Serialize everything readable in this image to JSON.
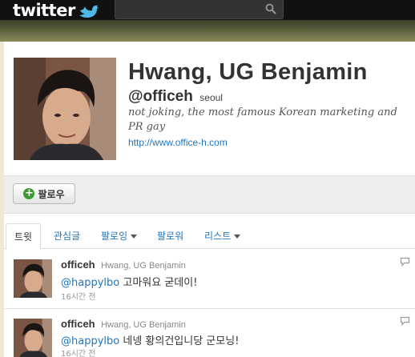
{
  "topbar": {
    "logo_text": "twitter",
    "search_placeholder": ""
  },
  "colors": {
    "accent": "#2276bb",
    "topbar": "#111111",
    "follow_plus": "#3c9a33"
  },
  "profile": {
    "full_name": "Hwang, UG Benjamin",
    "screen_name": "@officeh",
    "location": "seoul",
    "bio": "not joking, the most famous Korean marketing and PR gay",
    "url": "http://www.office-h.com"
  },
  "actions": {
    "follow_label": "팔로우"
  },
  "tabs": [
    {
      "label": "트윗",
      "active": true
    },
    {
      "label": "관심글",
      "active": false
    },
    {
      "label": "팔로잉",
      "active": false
    },
    {
      "label": "팔로워",
      "active": false
    },
    {
      "label": "리스트",
      "active": false
    }
  ],
  "tweets": [
    {
      "username": "officeh",
      "display_name": "Hwang, UG Benjamin",
      "mention": "@happylbo",
      "text": " 고마워요 굳데이!",
      "time": "16시간 전"
    },
    {
      "username": "officeh",
      "display_name": "Hwang, UG Benjamin",
      "mention": "@happylbo",
      "text": " 네넹 황의건입니당 군모닝!",
      "time": "16시간 전"
    }
  ]
}
